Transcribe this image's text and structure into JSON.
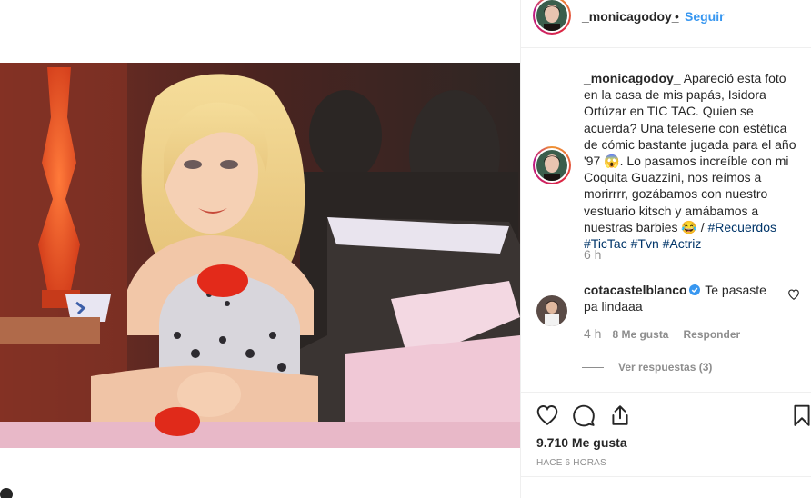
{
  "post": {
    "username": "_monicagodoy_",
    "separator": "•",
    "follow_label": "Seguir",
    "caption": {
      "username": "_monicagodoy_",
      "text": "Apareció esta foto en la casa de mis papás, Isidora Ortúzar en TIC TAC. Quien se acuerda? Una teleserie con estética de cómic bastante jugada para el año '97 😱. Lo pasamos increíble con mi Coquita Guazzini, nos reímos a morirrrr, gozábamos con nuestro vestuario kitsch y amábamos a nuestras barbies 😂 /",
      "hashtags": [
        "#Recuerdos",
        "#TicTac",
        "#Tvn",
        "#Actriz"
      ],
      "time": "6 h"
    },
    "comment": {
      "username": "cotacastelblanco",
      "text": "Te pasaste pa lindaaa",
      "time": "4 h",
      "likes": "8 Me gusta",
      "reply_label": "Responder",
      "view_replies": "Ver respuestas (3)"
    },
    "likes": "9.710 Me gusta",
    "time_ago": "HACE 6 HORAS"
  },
  "icons": {
    "like": "heart-icon",
    "comment": "comment-icon",
    "share": "share-icon",
    "save": "bookmark-icon",
    "verified": "verified-badge-icon"
  },
  "colors": {
    "link_blue": "#3897f0",
    "hashtag": "#003569",
    "muted": "#8e8e8e",
    "verified": "#3897f0"
  }
}
